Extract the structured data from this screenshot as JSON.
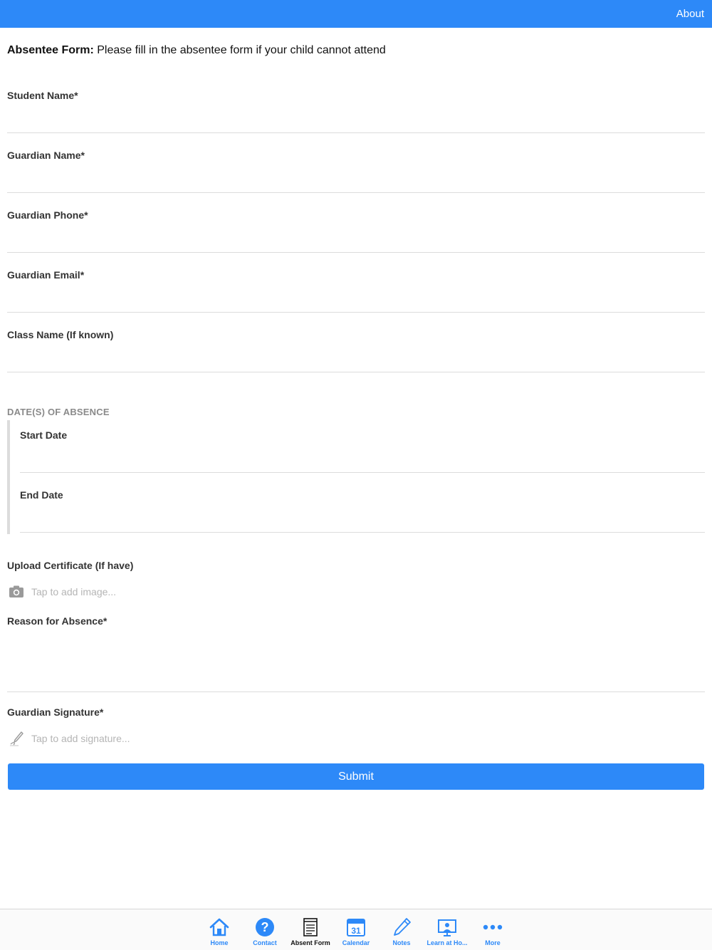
{
  "header": {
    "about_label": "About"
  },
  "intro": {
    "bold": "Absentee Form:",
    "text": " Please fill in the absentee form if your child cannot attend"
  },
  "fields": {
    "student_name": {
      "label": "Student Name*",
      "value": ""
    },
    "guardian_name": {
      "label": "Guardian Name*",
      "value": ""
    },
    "guardian_phone": {
      "label": "Guardian Phone*",
      "value": ""
    },
    "guardian_email": {
      "label": "Guardian Email*",
      "value": ""
    },
    "class_name": {
      "label": "Class Name (If known)",
      "value": ""
    }
  },
  "absence_dates": {
    "section_title": "DATE(S) OF ABSENCE",
    "start_date": {
      "label": "Start Date",
      "value": ""
    },
    "end_date": {
      "label": "End Date",
      "value": ""
    }
  },
  "upload": {
    "label": "Upload Certificate (If have)",
    "placeholder": "Tap to add image..."
  },
  "reason": {
    "label": "Reason for Absence*",
    "value": ""
  },
  "signature": {
    "label": "Guardian Signature*",
    "placeholder": "Tap to add signature..."
  },
  "submit_label": "Submit",
  "tabs": [
    {
      "label": "Home",
      "icon": "home-icon",
      "active": false
    },
    {
      "label": "Contact",
      "icon": "question-icon",
      "active": false
    },
    {
      "label": "Absent Form",
      "icon": "form-icon",
      "active": true
    },
    {
      "label": "Calendar",
      "icon": "calendar-icon",
      "calendar_day": "31",
      "active": false
    },
    {
      "label": "Notes",
      "icon": "pencil-icon",
      "active": false
    },
    {
      "label": "Learn at Ho...",
      "icon": "screen-icon",
      "active": false
    },
    {
      "label": "More",
      "icon": "more-icon",
      "active": false
    }
  ],
  "colors": {
    "accent": "#2d89f8",
    "label": "#333333",
    "placeholder": "#b5b5b5",
    "divider": "#dcdcdc"
  }
}
